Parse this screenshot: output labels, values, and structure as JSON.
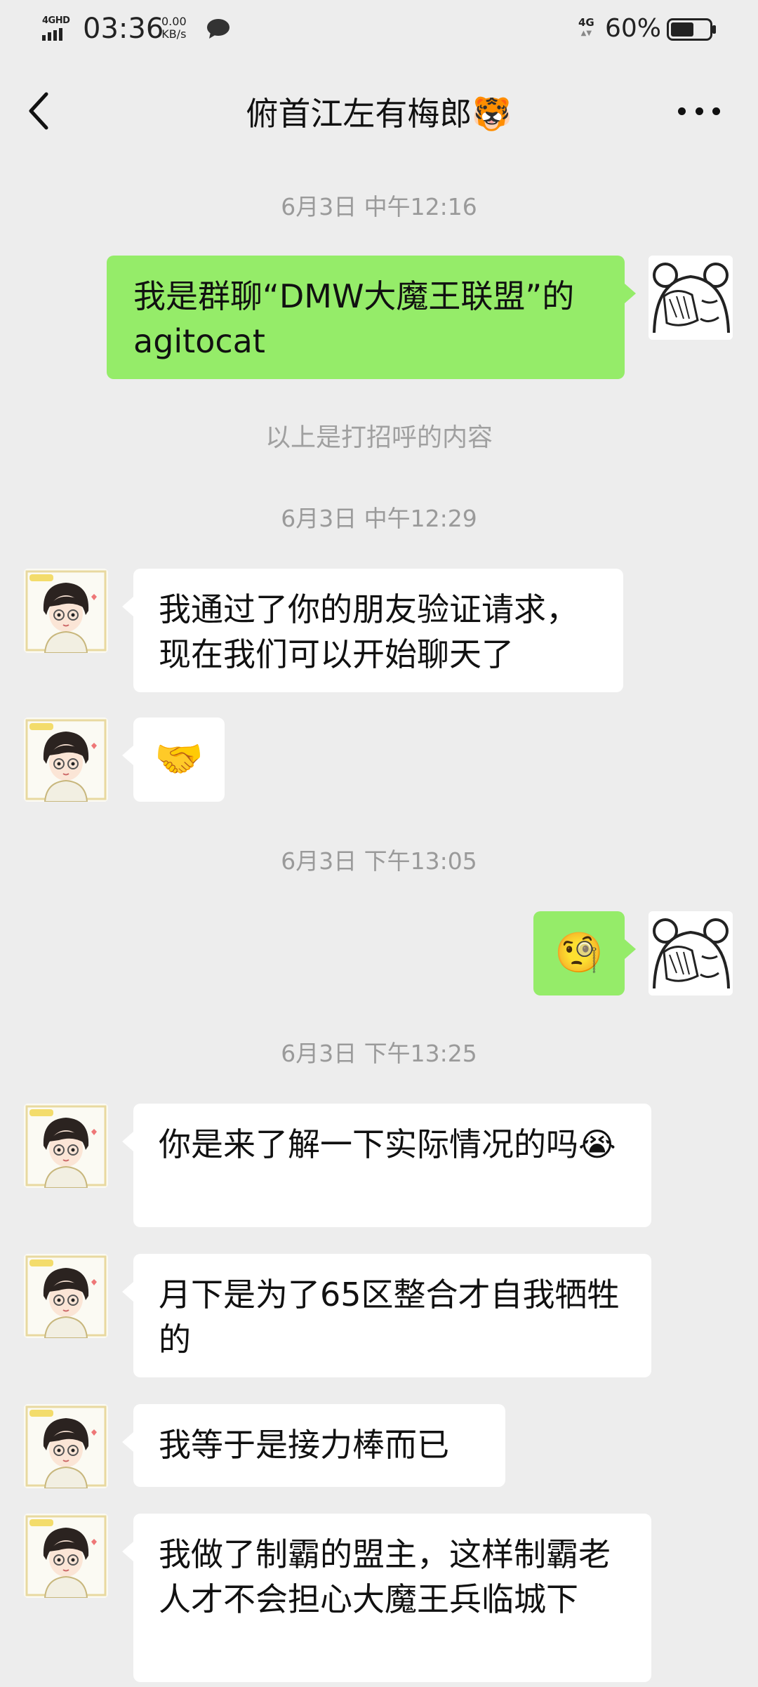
{
  "status_bar": {
    "network_label": "4GHD",
    "time": "03:36",
    "speed_value": "0.00",
    "speed_unit": "KB/s",
    "network_right": "4G",
    "battery_percent": "60%",
    "battery_level": 0.6
  },
  "header": {
    "title": "俯首江左有梅郎🐯"
  },
  "messages": [
    {
      "kind": "timestamp",
      "text": "6月3日 中午12:16"
    },
    {
      "kind": "outgoing",
      "text": "我是群聊“DMW大魔王联盟”的agitocat"
    },
    {
      "kind": "system",
      "text": "以上是打招呼的内容"
    },
    {
      "kind": "timestamp",
      "text": "6月3日 中午12:29"
    },
    {
      "kind": "incoming",
      "text": "我通过了你的朋友验证请求，现在我们可以开始聊天了"
    },
    {
      "kind": "incoming",
      "text": "🤝"
    },
    {
      "kind": "timestamp",
      "text": "6月3日 下午13:05"
    },
    {
      "kind": "outgoing",
      "text": "🧐"
    },
    {
      "kind": "timestamp",
      "text": "6月3日 下午13:25"
    },
    {
      "kind": "incoming",
      "text": "你是来了解一下实际情况的吗😭"
    },
    {
      "kind": "incoming",
      "text": "月下是为了65区整合才自我牺牲的"
    },
    {
      "kind": "incoming",
      "text": "我等于是接力棒而已"
    },
    {
      "kind": "incoming",
      "text": "我做了制霸的盟主，这样制霸老人才不会担心大魔王兵临城下"
    }
  ]
}
